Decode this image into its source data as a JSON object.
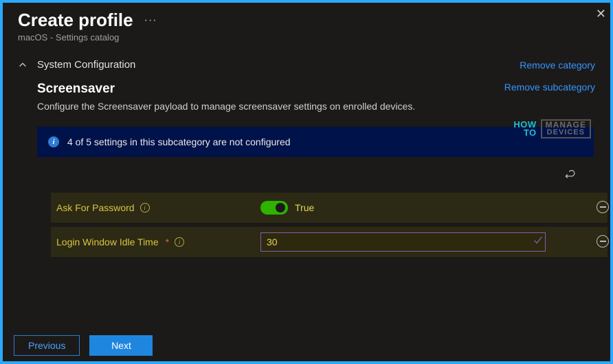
{
  "header": {
    "title": "Create profile",
    "subtitle": "macOS - Settings catalog"
  },
  "category": {
    "title": "System Configuration",
    "remove_label": "Remove category"
  },
  "subcategory": {
    "title": "Screensaver",
    "description": "Configure the Screensaver payload to manage screensaver settings on enrolled devices.",
    "remove_label": "Remove subcategory"
  },
  "banner": {
    "text": "4 of 5 settings in this subcategory are not configured"
  },
  "settings": {
    "ask_password": {
      "label": "Ask For Password",
      "value_label": "True"
    },
    "login_idle": {
      "label": "Login Window Idle Time",
      "value": "30"
    }
  },
  "footer": {
    "previous": "Previous",
    "next": "Next"
  },
  "watermark": {
    "how": "HOW",
    "to": "TO",
    "manage": "MANAGE",
    "devices": "DEVICES"
  }
}
